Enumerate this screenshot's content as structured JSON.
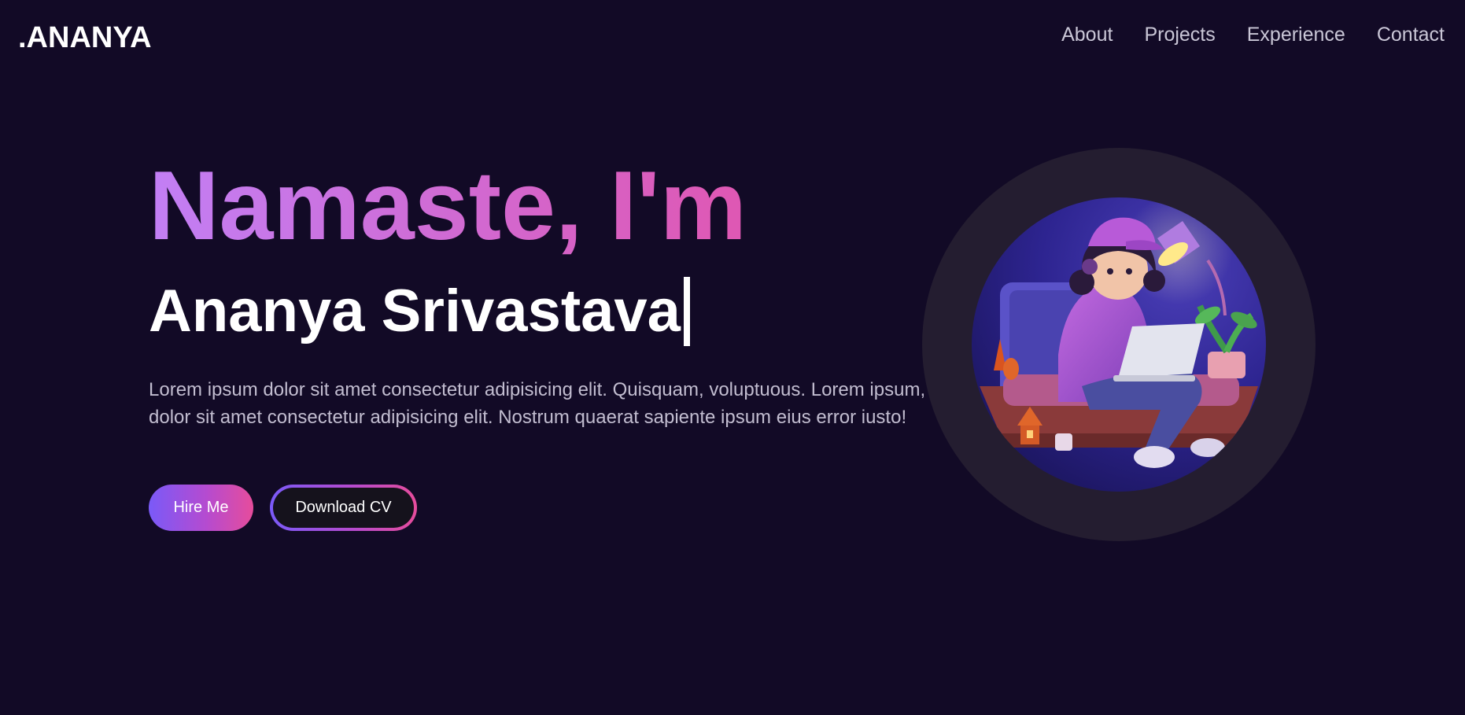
{
  "nav": {
    "logo": ".ANANYA",
    "links": [
      {
        "label": "About"
      },
      {
        "label": "Projects"
      },
      {
        "label": "Experience"
      },
      {
        "label": "Contact"
      }
    ]
  },
  "hero": {
    "greeting": "Namaste, I'm",
    "name": "Ananya Srivastava",
    "description": "Lorem ipsum dolor sit amet consectetur adipisicing elit. Quisquam, voluptuous. Lorem ipsum, dolor sit amet consectetur adipisicing elit. Nostrum quaerat sapiente ipsum eius error iusto!",
    "hire_label": "Hire Me",
    "cv_label": "Download CV"
  },
  "colors": {
    "background": "#120a26",
    "accent_purple": "#7a5af8",
    "accent_pink": "#e64c9c",
    "ring": "#241d30"
  }
}
